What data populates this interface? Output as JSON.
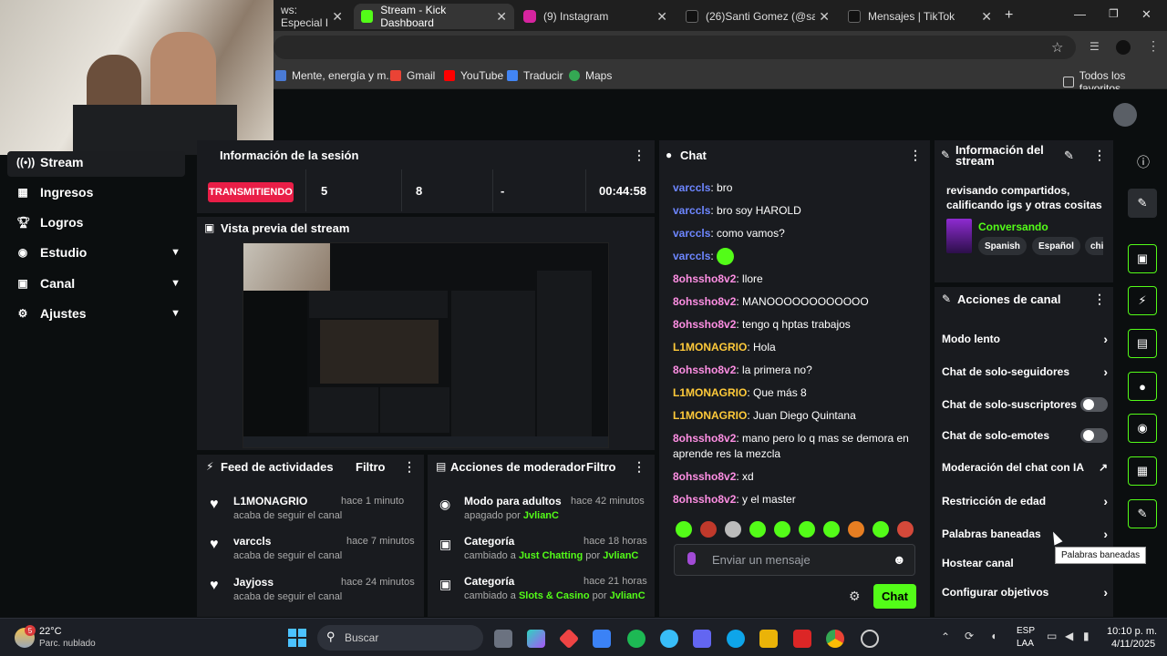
{
  "browser": {
    "tabs": [
      {
        "title": "ws: Especial I",
        "active": false
      },
      {
        "title": "Stream - Kick Dashboard",
        "active": true
      },
      {
        "title": "(9) Instagram",
        "active": false
      },
      {
        "title": "(26)Santi Gomez (@san.go",
        "active": false
      },
      {
        "title": "Mensajes | TikTok",
        "active": false
      }
    ],
    "bookmarks": [
      "Mente, energía y m...",
      "Gmail",
      "YouTube",
      "Traducir",
      "Maps"
    ],
    "all_bookmarks": "Todos los favoritos"
  },
  "sidebar": {
    "items": [
      {
        "label": "Stream",
        "icon": "broadcast-icon",
        "expandable": false
      },
      {
        "label": "Ingresos",
        "icon": "chart-icon",
        "expandable": false
      },
      {
        "label": "Logros",
        "icon": "trophy-icon",
        "expandable": false
      },
      {
        "label": "Estudio",
        "icon": "palette-icon",
        "expandable": true
      },
      {
        "label": "Canal",
        "icon": "video-icon",
        "expandable": true
      },
      {
        "label": "Ajustes",
        "icon": "gear-icon",
        "expandable": true
      }
    ]
  },
  "session": {
    "title": "Información de la sesión",
    "status": "TRANSMITIENDO",
    "viewers": "5",
    "followers": "8",
    "subs": "-",
    "duration": "00:44:58"
  },
  "preview": {
    "title": "Vista previa del stream"
  },
  "feed": {
    "title": "Feed de actividades",
    "filter": "Filtro",
    "items": [
      {
        "user": "L1MONAGRIO",
        "text": "acaba de seguir el canal",
        "time": "hace 1 minuto"
      },
      {
        "user": "varccls",
        "text": "acaba de seguir el canal",
        "time": "hace 7 minutos"
      },
      {
        "user": "Jayjoss",
        "text": "acaba de seguir el canal",
        "time": "hace 24 minutos"
      }
    ]
  },
  "mod": {
    "title": "Acciones de moderador",
    "filter": "Filtro",
    "items": [
      {
        "title": "Modo para adultos",
        "time": "hace 42 minutos",
        "line_a": "apagado por",
        "value": "",
        "line_b": "",
        "by": "JvlianC"
      },
      {
        "title": "Categoría",
        "time": "hace 18 horas",
        "line_a": "cambiado a",
        "value": "Just Chatting",
        "line_b": "por",
        "by": "JvlianC"
      },
      {
        "title": "Categoría",
        "time": "hace 21 horas",
        "line_a": "cambiado a",
        "value": "Slots & Casino",
        "line_b": "por",
        "by": "JvlianC"
      }
    ]
  },
  "chat": {
    "title": "Chat",
    "messages": [
      {
        "user": "varccls",
        "color": "blue",
        "text": "bro"
      },
      {
        "user": "varccls",
        "color": "blue",
        "text": "bro soy HAROLD"
      },
      {
        "user": "varccls",
        "color": "blue",
        "text": "como vamos?"
      },
      {
        "user": "varccls",
        "color": "blue",
        "text": ""
      },
      {
        "user": "8ohssho8v2",
        "color": "pink",
        "text": "llore"
      },
      {
        "user": "8ohssho8v2",
        "color": "pink",
        "text": "MANOOOOOOOOOOOO"
      },
      {
        "user": "8ohssho8v2",
        "color": "pink",
        "text": "tengo q hptas trabajos"
      },
      {
        "user": "L1MONAGRIO",
        "color": "gold",
        "text": "Hola"
      },
      {
        "user": "8ohssho8v2",
        "color": "pink",
        "text": "la primera no?"
      },
      {
        "user": "L1MONAGRIO",
        "color": "gold",
        "text": "Que más 8"
      },
      {
        "user": "L1MONAGRIO",
        "color": "gold",
        "text": "Juan Diego Quintana"
      },
      {
        "user": "8ohssho8v2",
        "color": "pink",
        "text": "mano pero lo q mas se demora en aprende res la mezcla"
      },
      {
        "user": "8ohssho8v2",
        "color": "pink",
        "text": "xd"
      },
      {
        "user": "8ohssho8v2",
        "color": "pink",
        "text": "y el master"
      }
    ],
    "input_placeholder": "Enviar un mensaje",
    "send": "Chat"
  },
  "stream_info": {
    "title": "Información del stream",
    "stream_title": "revisando compartidos, calificando igs y otras cositas",
    "category": "Conversando",
    "tags": [
      "Spanish",
      "Español",
      "chi"
    ]
  },
  "channel_actions": {
    "title": "Acciones de canal",
    "items": [
      {
        "label": "Modo lento",
        "type": "arrow"
      },
      {
        "label": "Chat de solo-seguidores",
        "type": "arrow"
      },
      {
        "label": "Chat de solo-suscriptores",
        "type": "toggle"
      },
      {
        "label": "Chat de solo-emotes",
        "type": "toggle"
      },
      {
        "label": "Moderación del chat con IA",
        "type": "external"
      },
      {
        "label": "Restricción de edad",
        "type": "arrow"
      },
      {
        "label": "Palabras baneadas",
        "type": "arrow"
      },
      {
        "label": "Hostear canal",
        "type": "none"
      },
      {
        "label": "Configurar objetivos",
        "type": "arrow"
      }
    ],
    "tooltip": "Palabras baneadas"
  },
  "taskbar": {
    "temp": "22°C",
    "weather": "Parc. nublado",
    "search": "Buscar",
    "lang": "ESP",
    "lang2": "LAA",
    "time": "10:10 p. m.",
    "date": "4/11/2025"
  },
  "colors": {
    "accent": "#53fc18",
    "live": "#e91e47"
  }
}
